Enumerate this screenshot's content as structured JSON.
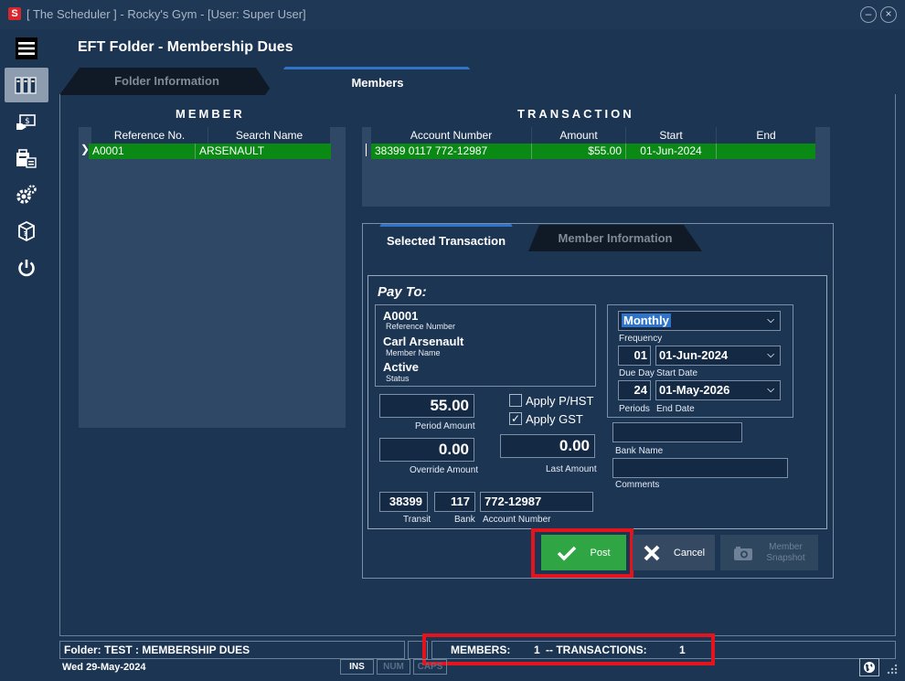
{
  "window": {
    "title": "[ The Scheduler ] - Rocky's Gym - [User: Super User]",
    "logo_letter": "S",
    "minimize": "–",
    "close": "×"
  },
  "page_title": "EFT Folder - Membership Dues",
  "tabs": [
    {
      "label": "Folder Information",
      "active": false
    },
    {
      "label": "Members",
      "active": true
    }
  ],
  "member_section": {
    "title": "MEMBER",
    "columns": [
      "Reference No.",
      "Search Name"
    ],
    "rows": [
      [
        "A0001",
        "ARSENAULT"
      ]
    ]
  },
  "transaction_section": {
    "title": "TRANSACTION",
    "columns": [
      "Account Number",
      "Amount",
      "Start",
      "End"
    ],
    "rows": [
      [
        "38399 0117 772-12987",
        "$55.00",
        "01-Jun-2024",
        ""
      ]
    ]
  },
  "subtabs": [
    {
      "label": "Selected Transaction",
      "active": true
    },
    {
      "label": "Member Information",
      "active": false
    }
  ],
  "pay_to": {
    "label": "Pay To:",
    "reference_number": "A0001",
    "reference_number_label": "Reference Number",
    "member_name": "Carl Arsenault",
    "member_name_label": "Member Name",
    "status": "Active",
    "status_label": "Status"
  },
  "amounts": {
    "period_amount": "55.00",
    "period_amount_label": "Period Amount",
    "override_amount": "0.00",
    "override_amount_label": "Override Amount",
    "last_amount": "0.00",
    "last_amount_label": "Last Amount"
  },
  "taxes": {
    "apply_phst_label": "Apply P/HST",
    "apply_phst_checked": false,
    "apply_gst_label": "Apply GST",
    "apply_gst_checked": true
  },
  "bank": {
    "transit": "38399",
    "transit_label": "Transit",
    "bank": "117",
    "bank_label": "Bank",
    "account_number": "772-12987",
    "account_number_label": "Account Number",
    "bank_name": "",
    "bank_name_label": "Bank Name",
    "comments": "",
    "comments_label": "Comments"
  },
  "schedule": {
    "frequency": "Monthly",
    "frequency_label": "Frequency",
    "due_day": "01",
    "due_day_label": "Due Day",
    "start_date": "01-Jun-2024",
    "start_date_label": "Start Date",
    "periods": "24",
    "periods_label": "Periods",
    "end_date": "01-May-2026",
    "end_date_label": "End Date"
  },
  "buttons": {
    "post": "Post",
    "cancel": "Cancel",
    "snapshot_line1": "Member",
    "snapshot_line2": "Snapshot"
  },
  "statusbar": {
    "folder": "Folder: TEST      : MEMBERSHIP DUES",
    "members_label": "MEMBERS:",
    "members_count": "1",
    "transactions_label": "-- TRANSACTIONS:",
    "transactions_count": "1",
    "date": "Wed  29-May-2024",
    "key_ins": "INS",
    "key_num": "NUM",
    "key_caps": "CAPS"
  },
  "colors": {
    "background": "#1c3553",
    "selected_row": "#0a8a14",
    "accent_tab": "#2f74c9",
    "post_button": "#2fa544",
    "highlight": "#e4141e"
  },
  "icons": [
    "hamburger-icon",
    "folders-icon",
    "payment-icon",
    "store-icon",
    "gear-icon",
    "package-icon",
    "power-icon",
    "globe-icon",
    "resize-grip-icon"
  ]
}
